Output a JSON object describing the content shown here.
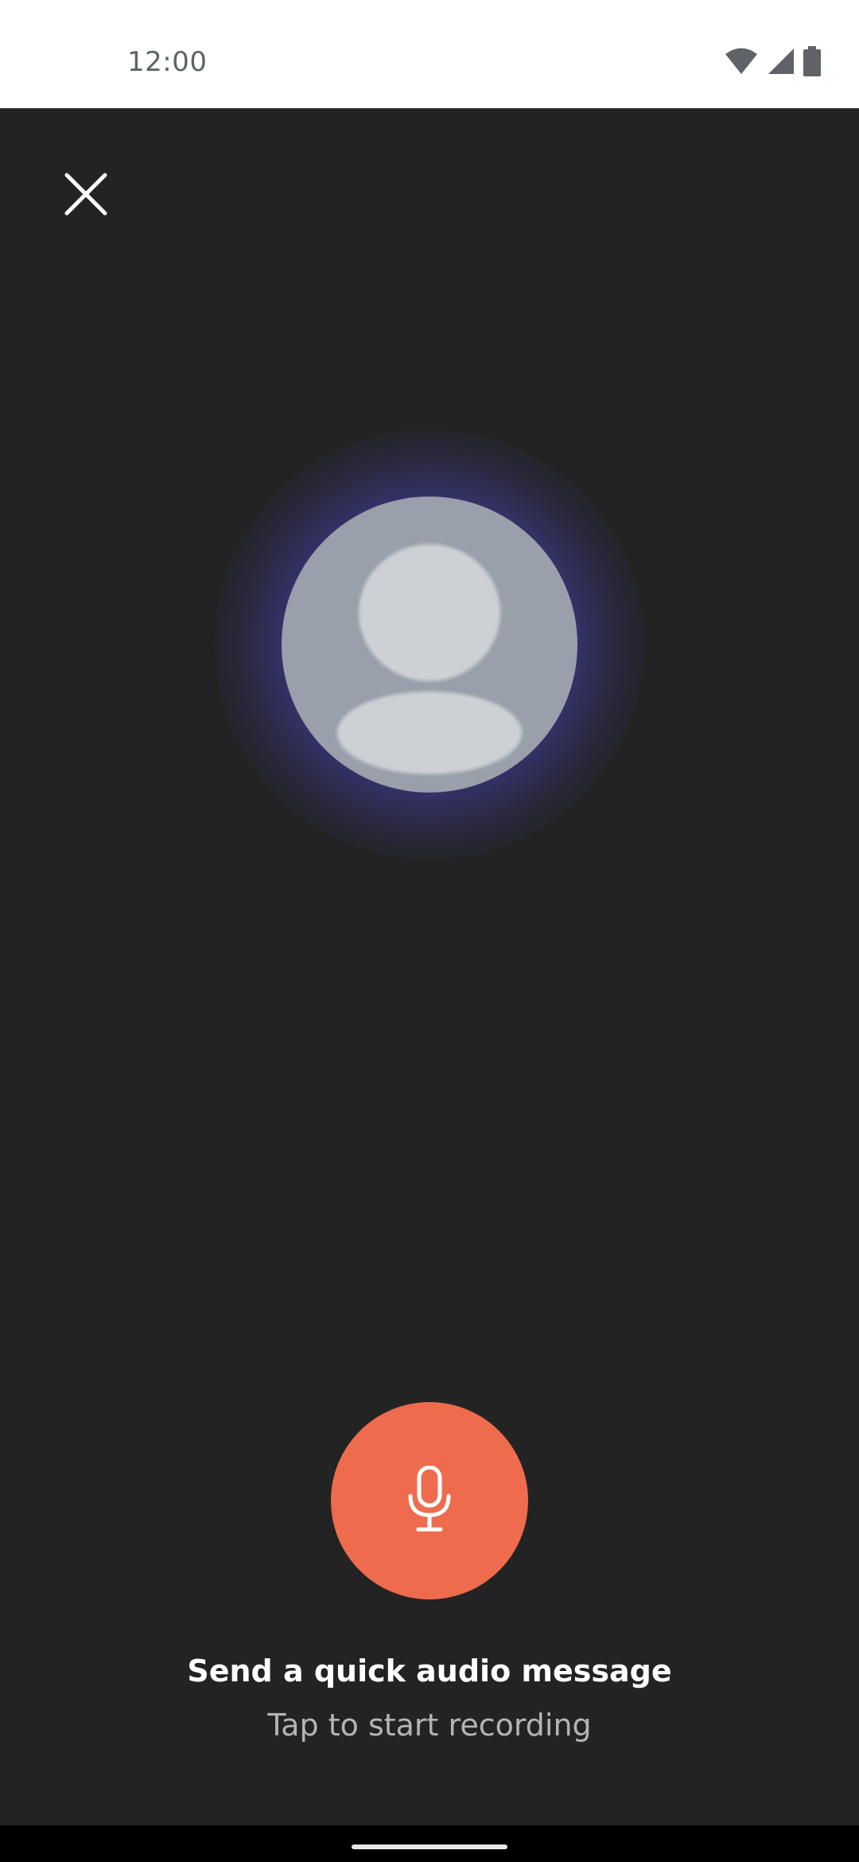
{
  "status_bar": {
    "time": "12:00",
    "icons": [
      "wifi-icon",
      "cellular-signal-icon",
      "battery-icon"
    ]
  },
  "header": {
    "close_icon": "close-icon"
  },
  "avatar": {
    "icon": "default-contact-avatar"
  },
  "recorder": {
    "mic_icon": "microphone-icon",
    "title": "Send a quick audio message",
    "subtitle": "Tap to start recording"
  },
  "colors": {
    "background": "#232323",
    "accent": "#ee6c4d",
    "glow": "#4646a0",
    "avatar_bg": "#9aa0ab"
  }
}
